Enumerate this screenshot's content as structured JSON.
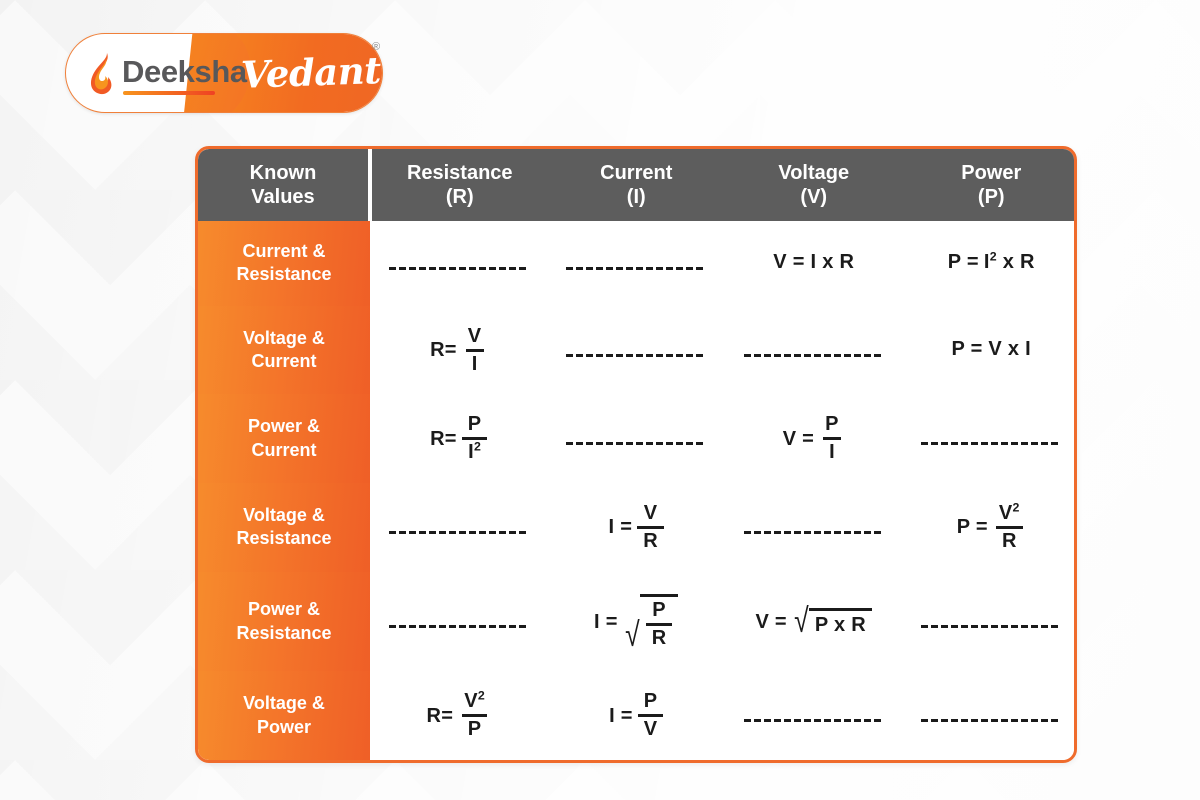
{
  "brand": {
    "primary_text": "Deeksha",
    "secondary_text": "Vedantu",
    "registered_mark": "®",
    "flame_icon": "flame-icon",
    "accent_orange": "#ef6b2c",
    "orange_light": "#f68b2c",
    "header_gray": "#5d5d5d"
  },
  "table": {
    "columns": [
      {
        "line1": "Known",
        "line2": "Values"
      },
      {
        "line1": "Resistance",
        "line2": "(R)"
      },
      {
        "line1": "Current",
        "line2": "(I)"
      },
      {
        "line1": "Voltage",
        "line2": "(V)"
      },
      {
        "line1": "Power",
        "line2": "(P)"
      }
    ],
    "rows": [
      {
        "label_line1": "Current &",
        "label_line2": "Resistance",
        "resistance": {
          "type": "none",
          "text": "--------------"
        },
        "current": {
          "type": "none",
          "text": "--------------"
        },
        "voltage": {
          "type": "inline",
          "text": "V = I x R"
        },
        "power": {
          "type": "sup",
          "lhs": "P =",
          "base": "I",
          "exp": "2",
          "tail": "x R"
        }
      },
      {
        "label_line1": "Voltage &",
        "label_line2": "Current",
        "resistance": {
          "type": "fraction",
          "lhs": "R=",
          "num": "V",
          "den": "I"
        },
        "current": {
          "type": "none",
          "text": "--------------"
        },
        "voltage": {
          "type": "none",
          "text": "--------------"
        },
        "power": {
          "type": "inline",
          "text": "P = V x I"
        }
      },
      {
        "label_line1": "Power &",
        "label_line2": "Current",
        "resistance": {
          "type": "fraction",
          "lhs": "R=",
          "num": "P",
          "den": "I",
          "den_exp": "2"
        },
        "current": {
          "type": "none",
          "text": "--------------"
        },
        "voltage": {
          "type": "fraction",
          "lhs": "V =",
          "num": "P",
          "den": "I"
        },
        "power": {
          "type": "none",
          "text": "--------------"
        }
      },
      {
        "label_line1": "Voltage &",
        "label_line2": "Resistance",
        "resistance": {
          "type": "none",
          "text": "--------------"
        },
        "current": {
          "type": "fraction",
          "lhs": "I =",
          "num": "V",
          "den": "R"
        },
        "voltage": {
          "type": "none",
          "text": "--------------"
        },
        "power": {
          "type": "fraction",
          "lhs": "P =",
          "num": "V",
          "num_exp": "2",
          "den": "R"
        }
      },
      {
        "label_line1": "Power &",
        "label_line2": "Resistance",
        "resistance": {
          "type": "none",
          "text": "--------------"
        },
        "current": {
          "type": "sqrt-fraction",
          "lhs": "I =",
          "num": "P",
          "den": "R"
        },
        "voltage": {
          "type": "sqrt-inline",
          "lhs": "V =",
          "radicand": "P x R"
        },
        "power": {
          "type": "none",
          "text": "--------------"
        }
      },
      {
        "label_line1": "Voltage &",
        "label_line2": "Power",
        "resistance": {
          "type": "fraction",
          "lhs": "R=",
          "num": "V",
          "num_exp": "2",
          "den": "P"
        },
        "current": {
          "type": "fraction",
          "lhs": "I =",
          "num": "P",
          "den": "V"
        },
        "voltage": {
          "type": "none",
          "text": "--------------"
        },
        "power": {
          "type": "none",
          "text": "--------------"
        }
      }
    ]
  }
}
